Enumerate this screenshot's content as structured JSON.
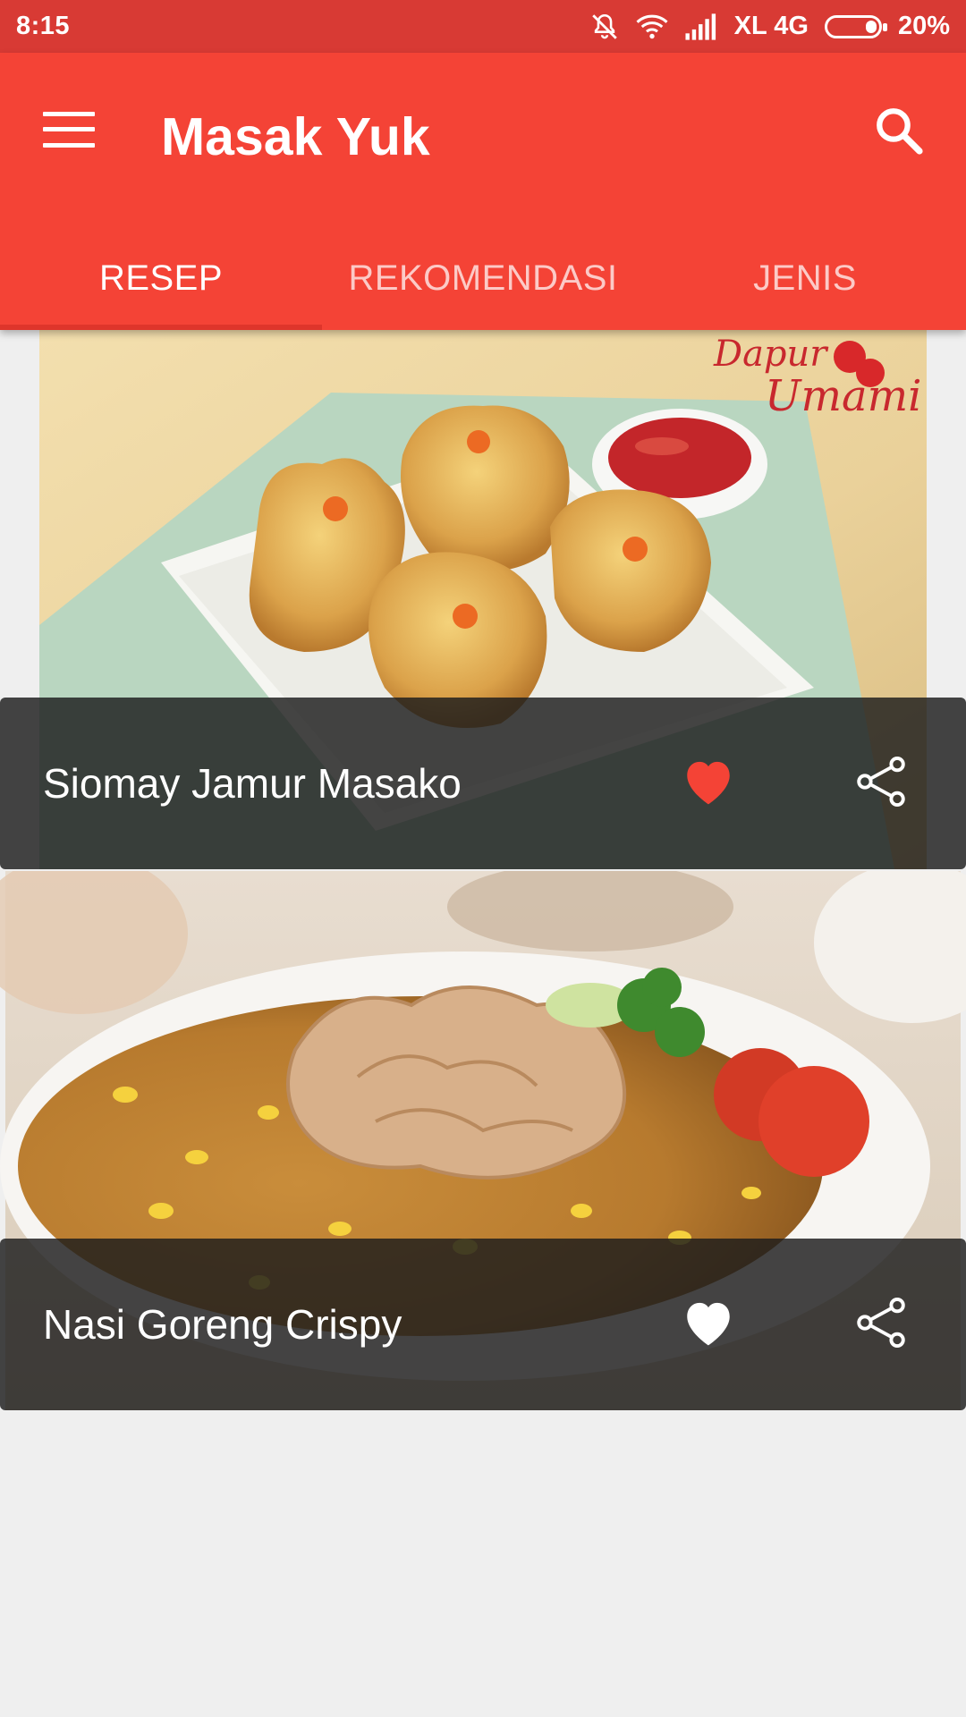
{
  "status_bar": {
    "time": "8:15",
    "carrier": "XL 4G",
    "battery": "20%",
    "battery_level": 0.2,
    "icons": [
      "silent-icon",
      "wifi-icon",
      "signal-icon",
      "battery-icon"
    ]
  },
  "app_bar": {
    "title": "Masak Yuk",
    "menu_icon": "hamburger-menu-icon",
    "search_icon": "search-icon",
    "color": "#f44336"
  },
  "tabs": [
    {
      "label": "RESEP",
      "active": true
    },
    {
      "label": "REKOMENDASI",
      "active": false
    },
    {
      "label": "JENIS",
      "active": false
    }
  ],
  "recipes": [
    {
      "title": "Siomay Jamur Masako",
      "favorite": true,
      "watermark": "Dapur Umami",
      "favorite_icon": "heart-icon",
      "share_icon": "share-icon"
    },
    {
      "title": "Nasi Goreng Crispy",
      "favorite": false,
      "favorite_icon": "heart-icon",
      "share_icon": "share-icon"
    }
  ],
  "colors": {
    "status_bar": "#d83a34",
    "accent": "#f44336",
    "favorite_active": "#f44336",
    "favorite_inactive": "#ffffff"
  }
}
